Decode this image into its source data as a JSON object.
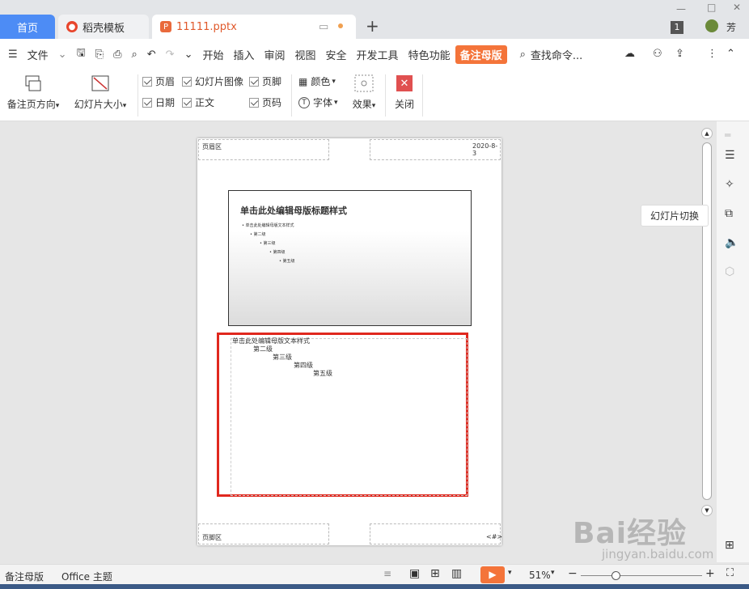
{
  "tabs": {
    "home": "首页",
    "daoke": "稻壳模板",
    "file": "11111.pptx",
    "add": "+",
    "badge": "1",
    "user": "芳"
  },
  "menu": {
    "file": "文件",
    "items": [
      "开始",
      "插入",
      "审阅",
      "视图",
      "安全",
      "开发工具",
      "特色功能"
    ],
    "active": "备注母版",
    "search": "查找命令..."
  },
  "ribbon": {
    "orientation": "备注页方向",
    "slide_size": "幻灯片大小",
    "checks": [
      {
        "label": "页眉",
        "checked": true
      },
      {
        "label": "幻灯片图像",
        "checked": true
      },
      {
        "label": "页脚",
        "checked": true
      },
      {
        "label": "日期",
        "checked": true
      },
      {
        "label": "正文",
        "checked": true
      },
      {
        "label": "页码",
        "checked": true
      }
    ],
    "color": "颜色",
    "font": "字体",
    "effect": "效果",
    "close": "关闭"
  },
  "page": {
    "header": "页眉区",
    "date": "2020-8-3",
    "footer": "页脚区",
    "pagenum": "<#>",
    "slide_title": "单击此处编辑母版标题样式",
    "slide_levels": [
      "单击此处编辑母版文本样式",
      "第二级",
      "第三级",
      "第四级",
      "第五级"
    ],
    "notes": [
      "单击此处编辑母版文本样式",
      "第二级",
      "第三级",
      "第四级",
      "第五级"
    ]
  },
  "tooltip": "幻灯片切换",
  "status": {
    "mode": "备注母版",
    "theme": "Office 主题",
    "zoom": "51%",
    "zoom_fraction": 0.51
  },
  "watermark": {
    "brand": "Bai经验",
    "site": "jingyan.baidu.com"
  },
  "colors": {
    "tab_home": "#4d8cf5",
    "active_menu": "#f4743a",
    "close_red": "#e05050",
    "highlight": "#e0281e"
  }
}
